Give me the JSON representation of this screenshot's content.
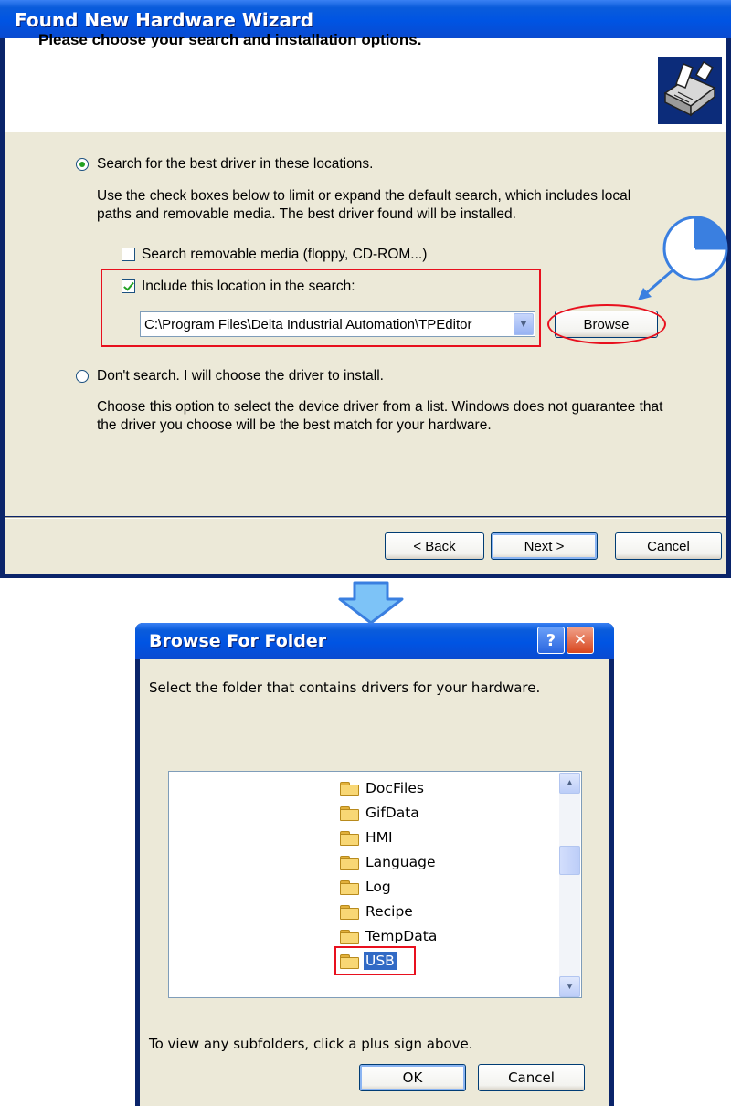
{
  "wizard": {
    "title": "Found New Hardware Wizard",
    "header_title": "Please choose your search and installation options.",
    "option_search": "Search for the best driver in these locations.",
    "search_desc_line1": "Use the check boxes below to limit or expand the default search, which includes local",
    "search_desc_line2": "paths and removable media. The best driver found will be installed.",
    "check_removable": "Search removable media (floppy, CD-ROM...)",
    "check_location": "Include this location in the search:",
    "location_value": "C:\\Program Files\\Delta Industrial Automation\\TPEditor",
    "browse_label": "Browse",
    "option_dont_search": "Don't search. I will choose the driver to install.",
    "dont_desc_line1": "Choose this option to select the device driver from a list.  Windows does not guarantee that",
    "dont_desc_line2": "the driver you choose will be the best match for your hardware.",
    "back_label": "< Back",
    "next_label": "Next >",
    "cancel_label": "Cancel"
  },
  "browse": {
    "title": "Browse For Folder",
    "help_label": "?",
    "close_label": "✕",
    "instruction": "Select the folder that contains drivers for your hardware.",
    "folders": [
      "DocFiles",
      "GifData",
      "HMI",
      "Language",
      "Log",
      "Recipe",
      "TempData",
      "USB"
    ],
    "selected_folder": "USB",
    "hint": "To view any subfolders, click a plus sign above.",
    "ok_label": "OK",
    "cancel_label": "Cancel"
  },
  "colors": {
    "highlight_red": "#e8101e",
    "annotation_blue": "#3a7fe0",
    "xp_title_blue": "#0054e3"
  },
  "icons": {
    "hardware": "hardware-install-icon",
    "folder": "folder-icon",
    "arrow": "down-arrow-icon",
    "pie": "pie-step-icon"
  }
}
